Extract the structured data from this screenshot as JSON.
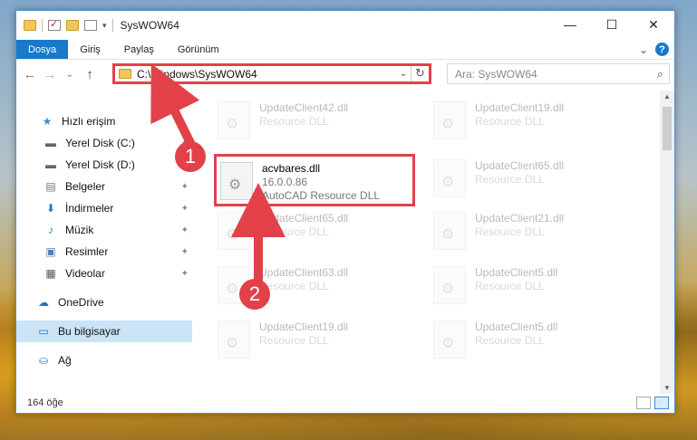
{
  "window": {
    "title": "SysWOW64",
    "minimize": "—",
    "maximize": "☐",
    "close": "✕"
  },
  "ribbon": {
    "tabs": [
      "Dosya",
      "Giriş",
      "Paylaş",
      "Görünüm"
    ],
    "collapse": "⌄",
    "help": "?"
  },
  "nav": {
    "back": "←",
    "forward": "→",
    "recent": "⌄",
    "up": "↑",
    "address": "C:\\Windows\\SysWOW64",
    "dropdown": "⌄",
    "refresh": "↻",
    "search_placeholder": "Ara: SysWOW64",
    "search_icon": "⌕"
  },
  "sidebar": {
    "items": [
      {
        "label": "Hızlı erişim",
        "icon": "star-icon",
        "glyph": "★",
        "color": "#3b8fd6"
      },
      {
        "label": "Yerel Disk (C:)",
        "icon": "drive-icon",
        "glyph": "▬",
        "color": "#666",
        "pinned": true
      },
      {
        "label": "Yerel Disk (D:)",
        "icon": "drive-icon",
        "glyph": "▬",
        "color": "#666",
        "pinned": true
      },
      {
        "label": "Belgeler",
        "icon": "documents-icon",
        "glyph": "▤",
        "color": "#777",
        "pinned": true
      },
      {
        "label": "İndirmeler",
        "icon": "download-icon",
        "glyph": "⬇",
        "color": "#1979ca",
        "pinned": true
      },
      {
        "label": "Müzik",
        "icon": "music-icon",
        "glyph": "♪",
        "color": "#1979ca",
        "pinned": true
      },
      {
        "label": "Resimler",
        "icon": "pictures-icon",
        "glyph": "▣",
        "color": "#4a7fb0",
        "pinned": true
      },
      {
        "label": "Videolar",
        "icon": "videos-icon",
        "glyph": "▦",
        "color": "#555",
        "pinned": true
      },
      {
        "label": "OneDrive",
        "icon": "onedrive-icon",
        "glyph": "☁",
        "color": "#1979ca"
      },
      {
        "label": "Bu bilgisayar",
        "icon": "computer-icon",
        "glyph": "▭",
        "color": "#1979ca",
        "selected": true
      },
      {
        "label": "Ağ",
        "icon": "network-icon",
        "glyph": "⛀",
        "color": "#1979ca"
      }
    ],
    "pin_glyph": "✦"
  },
  "files": [
    {
      "name": "UpdateClient42.dll",
      "type": "Resource DLL"
    },
    {
      "name": "UpdateClient19.dll",
      "type": "Resource DLL"
    },
    {
      "name": "acvbares.dll",
      "version": "16.0.0.86",
      "type": "AutoCAD Resource DLL"
    },
    {
      "name": "UpdateClient65.dll",
      "type": "Resource DLL"
    },
    {
      "name": "UpdateClient65.dll",
      "type": "Resource DLL"
    },
    {
      "name": "UpdateClient21.dll",
      "type": "Resource DLL"
    },
    {
      "name": "UpdateClient63.dll",
      "type": "Resource DLL"
    },
    {
      "name": "UpdateClient5.dll",
      "type": "Resource DLL"
    },
    {
      "name": "UpdateClient19.dll",
      "type": "Resource DLL"
    },
    {
      "name": "UpdateClient5.dll",
      "type": "Resource DLL"
    }
  ],
  "status": {
    "count": "164 öğe"
  },
  "callouts": [
    "1",
    "2"
  ],
  "colors": {
    "accent": "#1979ca",
    "highlight": "#e2414a"
  }
}
